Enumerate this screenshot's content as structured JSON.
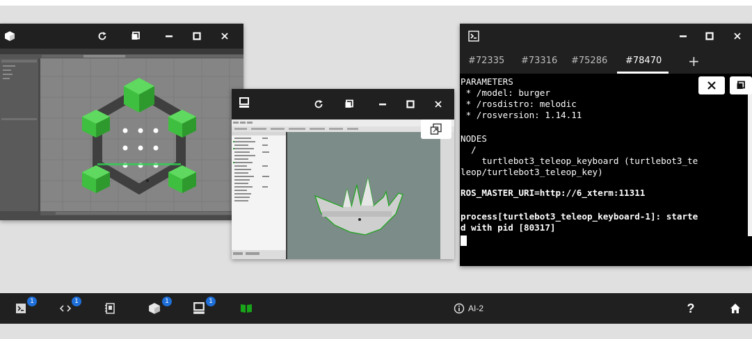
{
  "gazebo_window": {
    "refresh_icon": "refresh-icon",
    "restore_icon": "restore-icon"
  },
  "rviz_window": {
    "title_icon": "monitor-icon"
  },
  "terminal": {
    "tabs": [
      {
        "label": "#72335"
      },
      {
        "label": "#73316"
      },
      {
        "label": "#75286"
      },
      {
        "label": "#78470"
      }
    ],
    "add_tab_label": "+",
    "lines": [
      "PARAMETERS",
      " * /model: burger",
      " * /rosdistro: melodic",
      " * /rosversion: 1.14.11",
      "",
      "NODES",
      "  /",
      "    turtlebot3_teleop_keyboard (turtlebot3_te",
      "leop/turtlebot3_teleop_key)",
      "",
      "ROS_MASTER_URI=http://6_xterm:11311",
      "",
      "process[turtlebot3_teleop_keyboard-1]: starte",
      "d with pid [80317]"
    ]
  },
  "taskbar": {
    "badges": [
      "1",
      "1",
      "1",
      "1"
    ],
    "ai_label": "AI-2",
    "help_label": "?"
  },
  "colors": {
    "accent": "#1e6fd9",
    "gazebo_green": "#3fbf3f",
    "rviz_green": "#19a519"
  }
}
